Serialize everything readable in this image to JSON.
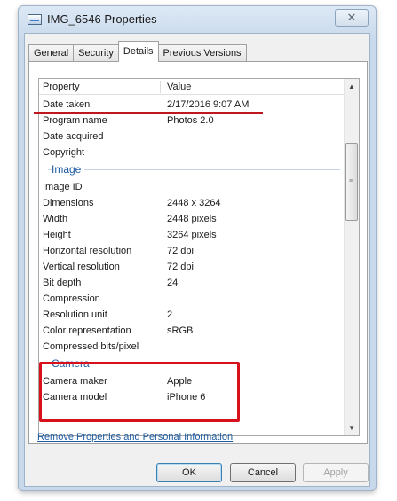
{
  "window": {
    "title": "IMG_6546 Properties",
    "close_glyph": "✕"
  },
  "tabs": [
    {
      "label": "General",
      "active": false
    },
    {
      "label": "Security",
      "active": false
    },
    {
      "label": "Details",
      "active": true
    },
    {
      "label": "Previous Versions",
      "active": false
    }
  ],
  "details": {
    "header": {
      "property": "Property",
      "value": "Value"
    },
    "rows_top": [
      {
        "property": "Date taken",
        "value": "2/17/2016 9:07 AM"
      },
      {
        "property": "Program name",
        "value": "Photos 2.0"
      },
      {
        "property": "Date acquired",
        "value": ""
      },
      {
        "property": "Copyright",
        "value": ""
      }
    ],
    "group_image": "Image",
    "rows_image": [
      {
        "property": "Image ID",
        "value": ""
      },
      {
        "property": "Dimensions",
        "value": "2448 x 3264"
      },
      {
        "property": "Width",
        "value": "2448 pixels"
      },
      {
        "property": "Height",
        "value": "3264 pixels"
      },
      {
        "property": "Horizontal resolution",
        "value": "72 dpi"
      },
      {
        "property": "Vertical resolution",
        "value": "72 dpi"
      },
      {
        "property": "Bit depth",
        "value": "24"
      },
      {
        "property": "Compression",
        "value": ""
      },
      {
        "property": "Resolution unit",
        "value": "2"
      },
      {
        "property": "Color representation",
        "value": "sRGB"
      },
      {
        "property": "Compressed bits/pixel",
        "value": ""
      }
    ],
    "group_camera": "Camera",
    "rows_camera": [
      {
        "property": "Camera maker",
        "value": "Apple"
      },
      {
        "property": "Camera model",
        "value": "iPhone 6"
      }
    ]
  },
  "remove_link": "Remove Properties and Personal Information",
  "buttons": {
    "ok": "OK",
    "cancel": "Cancel",
    "apply": "Apply"
  },
  "colors": {
    "annotation_red": "#d8101c",
    "link_blue": "#1e5aa0"
  },
  "icons": {
    "title_icon": "image-file-icon",
    "scroll_up": "scroll-up-arrow-icon",
    "scroll_down": "scroll-down-arrow-icon"
  }
}
